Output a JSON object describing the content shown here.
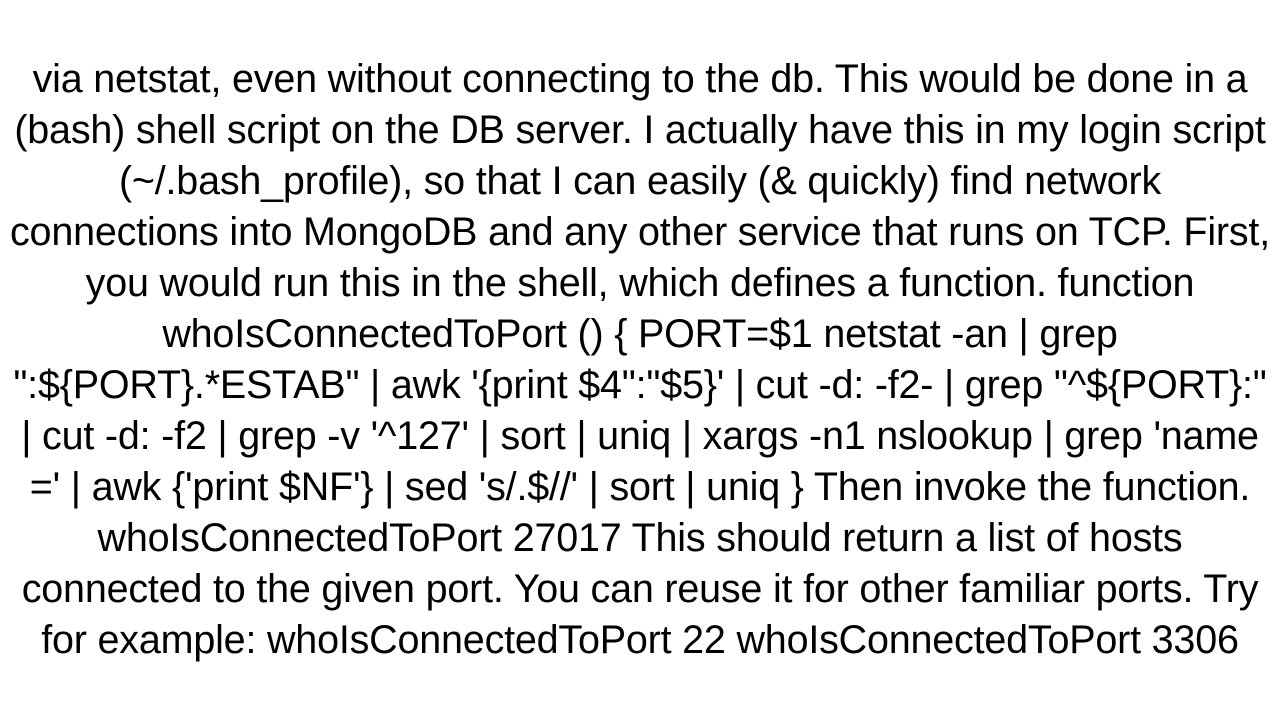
{
  "text": "via netstat, even without connecting to the db.  This would be done in a (bash) shell script on the DB server.  I actually have this in my login script (~/.bash_profile), so that I can easily (& quickly) find network connections into MongoDB and any other service that runs on TCP. First, you would run this in the shell, which defines a function. function whoIsConnectedToPort () {     PORT=$1     netstat -an | grep \":${PORT}.*ESTAB\" | awk '{print $4\":\"$5}' | cut -d: -f2- | grep \"^${PORT}:\" | cut -d: -f2 | grep -v '^127' | sort | uniq | xargs -n1 nslookup | grep 'name =' | awk {'print $NF'} | sed 's/.$//' | sort | uniq }  Then invoke the function. whoIsConnectedToPort 27017  This should return a list of hosts connected to the given port. You can reuse it for other familiar ports.  Try for example: whoIsConnectedToPort 22 whoIsConnectedToPort 3306"
}
